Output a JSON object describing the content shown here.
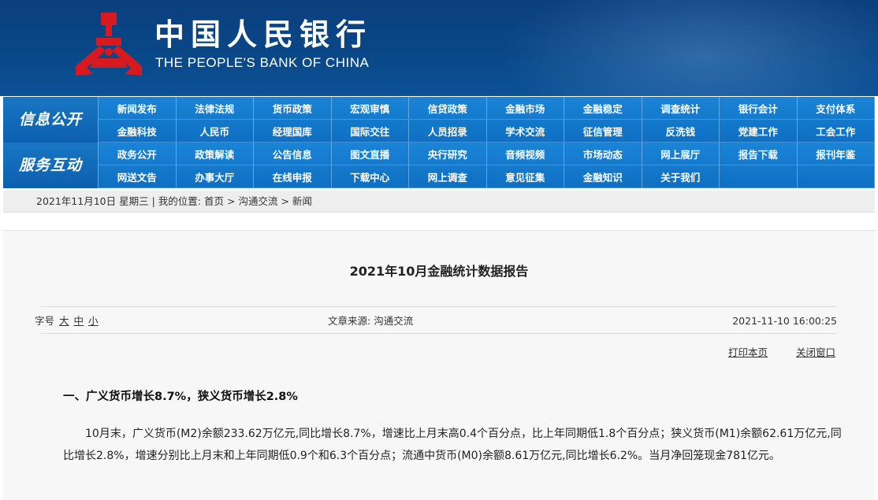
{
  "header": {
    "logo_cn": "中国人民银行",
    "logo_en": "THE PEOPLE'S BANK OF CHINA",
    "brand_red": "#d71920",
    "banner_blue": "#0a4787"
  },
  "nav": {
    "group1": {
      "label": "信息公开",
      "items": [
        "新闻发布",
        "法律法规",
        "货币政策",
        "宏观审慎",
        "信贷政策",
        "金融市场",
        "金融稳定",
        "调查统计",
        "银行会计",
        "支付体系",
        "金融科技",
        "人民币",
        "经理国库",
        "国际交往",
        "人员招录",
        "学术交流",
        "征信管理",
        "反洗钱",
        "党建工作",
        "工会工作"
      ]
    },
    "group2": {
      "label": "服务互动",
      "items": [
        "政务公开",
        "政策解读",
        "公告信息",
        "图文直播",
        "央行研究",
        "音频视频",
        "市场动态",
        "网上展厅",
        "报告下载",
        "报刊年鉴",
        "网送文告",
        "办事大厅",
        "在线申报",
        "下载中心",
        "网上调查",
        "意见征集",
        "金融知识",
        "关于我们"
      ]
    }
  },
  "breadcrumb": {
    "date": "2021年11月10日 星期三",
    "location_label": "我的位置:",
    "home": "首页",
    "section": "沟通交流",
    "current": "新闻"
  },
  "article": {
    "title": "2021年10月金融统计数据报告",
    "font_size_label": "字号",
    "font_large": "大",
    "font_medium": "中",
    "font_small": "小",
    "source_label": "文章来源:",
    "source": "沟通交流",
    "datetime": "2021-11-10 16:00:25",
    "print_label": "打印本页",
    "close_label": "关闭窗口",
    "section_heading": "一、广义货币增长8.7%，狭义货币增长2.8%",
    "paragraph": "10月末，广义货币(M2)余额233.62万亿元,同比增长8.7%，增速比上月末高0.4个百分点，比上年同期低1.8个百分点；狭义货币(M1)余额62.61万亿元,同比增长2.8%，增速分别比上月末和上年同期低0.9个和6.3个百分点；流通中货币(M0)余额8.61万亿元,同比增长6.2%。当月净回笼现金781亿元。"
  }
}
